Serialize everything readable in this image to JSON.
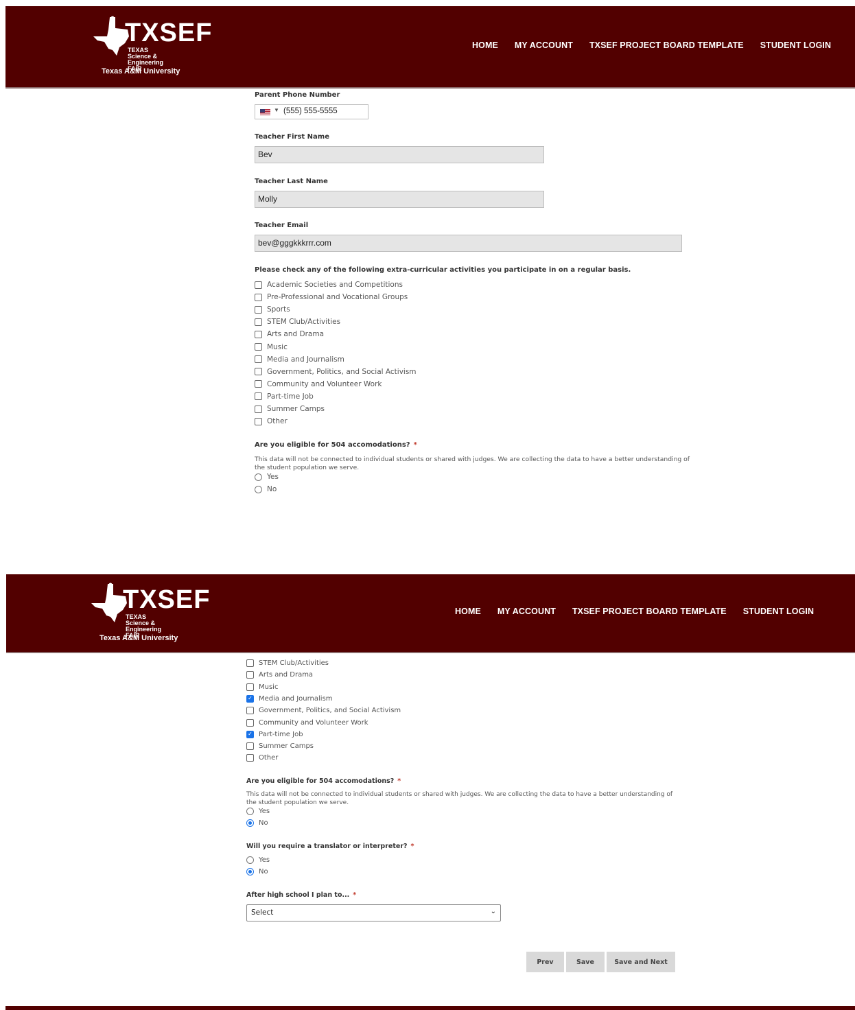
{
  "brand": {
    "logo_text": "TXSEF",
    "logo_sub_line1": "TEXAS Science &",
    "logo_sub_line2": "Engineering FAIR",
    "university": "Texas A&M University",
    "color": "#520000"
  },
  "nav": {
    "home": "HOME",
    "account": "MY ACCOUNT",
    "template": "TXSEF PROJECT BOARD TEMPLATE",
    "login": "STUDENT LOGIN"
  },
  "top": {
    "parent_phone_label": "Parent Phone Number",
    "parent_phone_value": "(555) 555-5555",
    "teacher_first_label": "Teacher First Name",
    "teacher_first_value": "Bev",
    "teacher_last_label": "Teacher Last Name",
    "teacher_last_value": "Molly",
    "teacher_email_label": "Teacher Email",
    "teacher_email_value": "bev@gggkkkrrr.com",
    "activities_label": "Please check any of the following extra-curricular activities you participate in on a regular basis.",
    "activities": [
      "Academic Societies and Competitions",
      "Pre-Professional and Vocational Groups",
      "Sports",
      "STEM Club/Activities",
      "Arts and Drama",
      "Music",
      "Media and Journalism",
      "Government, Politics, and Social Activism",
      "Community and Volunteer Work",
      "Part-time Job",
      "Summer Camps",
      "Other"
    ],
    "q504_label": "Are you eligible for 504 accomodations?",
    "q504_required": "*",
    "q504_note": "This data will not be connected to individual students or shared with judges. We are collecting the data to have a better understanding of the student population we serve.",
    "yes": "Yes",
    "no": "No"
  },
  "bottom": {
    "activities": [
      {
        "label": "STEM Club/Activities",
        "checked": false
      },
      {
        "label": "Arts and Drama",
        "checked": false
      },
      {
        "label": "Music",
        "checked": false
      },
      {
        "label": "Media and Journalism",
        "checked": true
      },
      {
        "label": "Government, Politics, and Social Activism",
        "checked": false
      },
      {
        "label": "Community and Volunteer Work",
        "checked": false
      },
      {
        "label": "Part-time Job",
        "checked": true
      },
      {
        "label": "Summer Camps",
        "checked": false
      },
      {
        "label": "Other",
        "checked": false
      }
    ],
    "q504_label": "Are you eligible for 504 accomodations?",
    "q504_required": "*",
    "q504_note": "This data will not be connected to individual students or shared with judges. We are collecting the data to have a better understanding of the student population we serve.",
    "q504_selected": "No",
    "translator_label": "Will you require a translator or interpreter?",
    "translator_required": "*",
    "translator_selected": "No",
    "yes": "Yes",
    "no": "No",
    "plan_label": "After high school I plan to...",
    "plan_required": "*",
    "plan_value": "Select",
    "prev": "Prev",
    "save": "Save",
    "save_next": "Save and Next"
  }
}
